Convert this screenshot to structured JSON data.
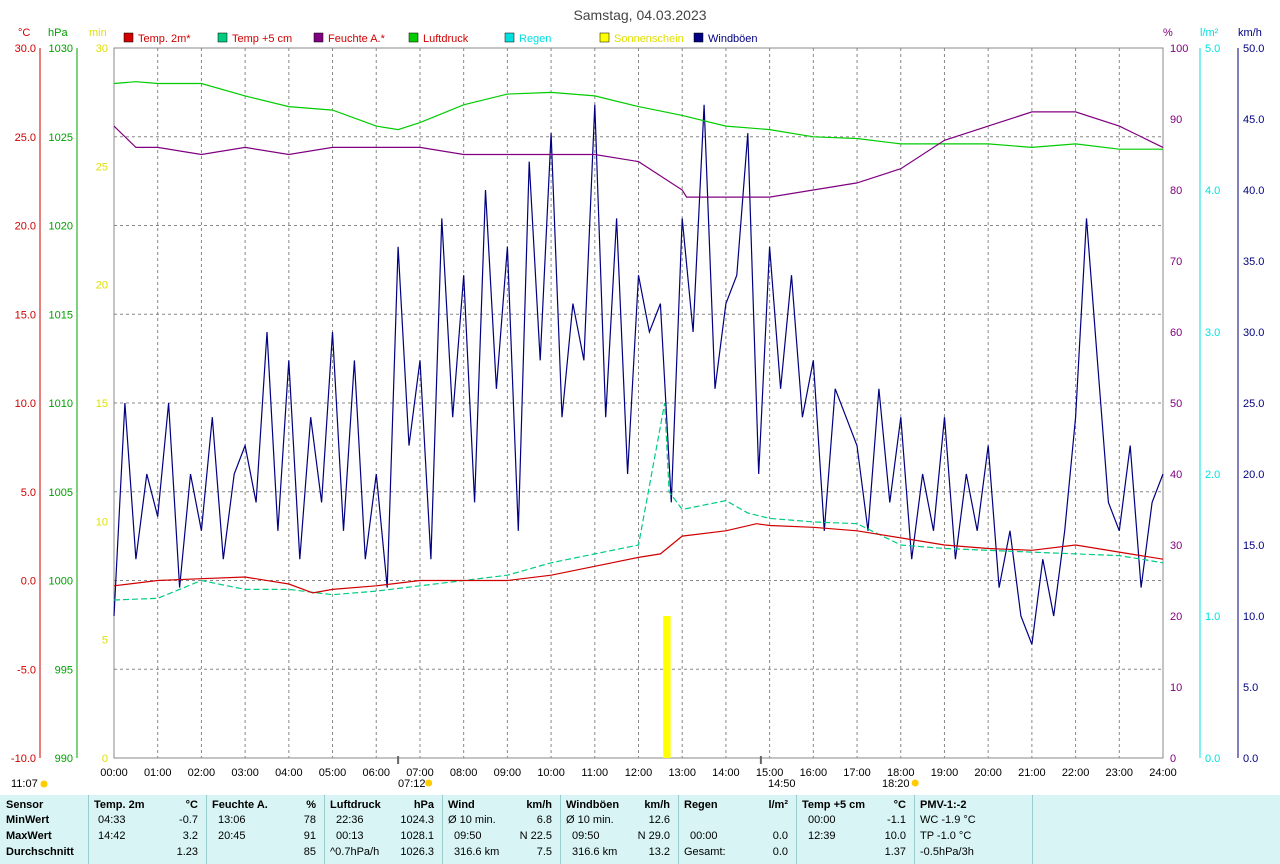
{
  "title": "Samstag, 04.03.2023",
  "units": {
    "temp": "°C",
    "pressure": "hPa",
    "sun": "min",
    "humidity": "%",
    "rain": "l/m²",
    "wind": "km/h"
  },
  "legend": [
    {
      "label": "Temp. 2m*",
      "color": "#d00000",
      "text_color": "#d00000"
    },
    {
      "label": "Temp +5 cm",
      "color": "#00cc80",
      "text_color": "#d00000"
    },
    {
      "label": "Feuchte A.*",
      "color": "#800080",
      "text_color": "#d00000"
    },
    {
      "label": "Luftdruck",
      "color": "#00cc00",
      "text_color": "#d00000"
    },
    {
      "label": "Regen",
      "color": "#00e0e0",
      "text_color": "#00e0e0"
    },
    {
      "label": "Sonnenschein",
      "color": "#ffff00",
      "text_color": "#e0e000"
    },
    {
      "label": "Windböen",
      "color": "#000080",
      "text_color": "#000080"
    }
  ],
  "axes": {
    "temp_ticks": [
      "30.0",
      "25.0",
      "20.0",
      "15.0",
      "10.0",
      "5.0",
      "0.0",
      "-5.0",
      "-10.0"
    ],
    "pressure_ticks": [
      "1030",
      "1025",
      "1020",
      "1015",
      "1010",
      "1005",
      "1000",
      "995",
      "990"
    ],
    "sun_ticks": [
      "30",
      "25",
      "20",
      "15",
      "10",
      "5",
      "0"
    ],
    "humidity_ticks": [
      "100",
      "90",
      "80",
      "70",
      "60",
      "50",
      "40",
      "30",
      "20",
      "10",
      "0"
    ],
    "rain_ticks": [
      "5.0",
      "4.0",
      "3.0",
      "2.0",
      "1.0",
      "0.0"
    ],
    "wind_ticks": [
      "50.0",
      "45.0",
      "40.0",
      "35.0",
      "30.0",
      "25.0",
      "20.0",
      "15.0",
      "10.0",
      "5.0",
      "0.0"
    ],
    "x_ticks": [
      "00:00",
      "01:00",
      "02:00",
      "03:00",
      "04:00",
      "05:00",
      "06:00",
      "07:00",
      "08:00",
      "09:00",
      "10:00",
      "11:00",
      "12:00",
      "13:00",
      "14:00",
      "15:00",
      "16:00",
      "17:00",
      "18:00",
      "19:00",
      "20:00",
      "21:00",
      "22:00",
      "23:00",
      "24:00"
    ]
  },
  "sun_markers": {
    "noon": "11:07",
    "sunrise": "07:12",
    "sunset": "18:20",
    "moon": "14:50"
  },
  "chart_data": {
    "type": "line",
    "title": "Samstag, 04.03.2023",
    "x_unit": "hour",
    "xlim": [
      0,
      24
    ],
    "series": [
      {
        "name": "Temp. 2m*",
        "axis": "temp",
        "ylim": [
          -10,
          30
        ],
        "x": [
          0,
          1,
          2,
          3,
          4,
          4.55,
          5,
          6,
          7,
          8,
          9,
          10,
          11,
          12,
          12.5,
          13,
          14,
          14.7,
          15,
          16,
          17,
          18,
          19,
          20,
          21,
          22,
          23,
          24
        ],
        "values": [
          -0.3,
          0.0,
          0.1,
          0.2,
          -0.2,
          -0.7,
          -0.5,
          -0.3,
          0.0,
          0.0,
          0.0,
          0.3,
          0.8,
          1.3,
          1.5,
          2.5,
          2.8,
          3.2,
          3.1,
          3.0,
          2.8,
          2.4,
          2.0,
          1.8,
          1.7,
          2.0,
          1.6,
          1.2
        ]
      },
      {
        "name": "Temp +5 cm",
        "axis": "temp",
        "ylim": [
          -10,
          30
        ],
        "x": [
          0,
          1,
          2,
          3,
          4,
          5,
          6,
          7,
          8,
          9,
          10,
          11,
          12,
          12.6,
          12.7,
          13,
          14,
          14.5,
          15,
          16,
          17,
          18,
          19,
          20,
          21,
          22,
          23,
          24
        ],
        "values": [
          -1.1,
          -1.0,
          0.0,
          -0.5,
          -0.5,
          -0.8,
          -0.6,
          -0.3,
          0.0,
          0.3,
          1.0,
          1.5,
          2.0,
          10.0,
          5.0,
          4.0,
          4.5,
          3.8,
          3.5,
          3.3,
          3.2,
          2.0,
          1.8,
          1.7,
          1.6,
          1.5,
          1.4,
          1.0
        ]
      },
      {
        "name": "Feuchte A.*",
        "axis": "humidity",
        "ylim": [
          0,
          100
        ],
        "x": [
          0,
          0.5,
          1,
          2,
          3,
          4,
          5,
          6,
          7,
          8,
          9,
          10,
          11,
          12,
          13,
          13.1,
          13.5,
          14,
          15,
          16,
          17,
          18,
          19,
          20,
          21,
          22,
          23,
          24
        ],
        "values": [
          89,
          86,
          86,
          85,
          86,
          85,
          86,
          86,
          86,
          85,
          85,
          85,
          85,
          84,
          80,
          79,
          79,
          79,
          79,
          80,
          81,
          83,
          87,
          89,
          91,
          91,
          89,
          86
        ]
      },
      {
        "name": "Luftdruck",
        "axis": "pressure",
        "ylim": [
          990,
          1030
        ],
        "x": [
          0,
          0.5,
          1,
          2,
          3,
          4,
          5,
          6,
          6.5,
          7,
          8,
          9,
          10,
          11,
          12,
          13,
          14,
          15,
          16,
          17,
          18,
          19,
          20,
          21,
          22,
          23,
          24
        ],
        "values": [
          1028.0,
          1028.1,
          1028.0,
          1028.0,
          1027.3,
          1026.7,
          1026.5,
          1025.6,
          1025.4,
          1025.8,
          1026.8,
          1027.4,
          1027.5,
          1027.3,
          1026.7,
          1026.2,
          1025.6,
          1025.4,
          1025.0,
          1024.9,
          1024.6,
          1024.6,
          1024.6,
          1024.4,
          1024.6,
          1024.3,
          1024.3
        ]
      },
      {
        "name": "Windböen",
        "axis": "wind",
        "ylim": [
          0,
          50
        ],
        "x": [
          0,
          0.25,
          0.5,
          0.75,
          1,
          1.25,
          1.5,
          1.75,
          2,
          2.25,
          2.5,
          2.75,
          3,
          3.25,
          3.5,
          3.75,
          4,
          4.25,
          4.5,
          4.75,
          5,
          5.25,
          5.5,
          5.75,
          6,
          6.25,
          6.5,
          6.75,
          7,
          7.25,
          7.5,
          7.75,
          8,
          8.25,
          8.5,
          8.75,
          9,
          9.25,
          9.5,
          9.75,
          10,
          10.25,
          10.5,
          10.75,
          11,
          11.25,
          11.5,
          11.75,
          12,
          12.25,
          12.5,
          12.75,
          13,
          13.25,
          13.5,
          13.75,
          14,
          14.25,
          14.5,
          14.75,
          15,
          15.25,
          15.5,
          15.75,
          16,
          16.25,
          16.5,
          16.75,
          17,
          17.25,
          17.5,
          17.75,
          18,
          18.25,
          18.5,
          18.75,
          19,
          19.25,
          19.5,
          19.75,
          20,
          20.25,
          20.5,
          20.75,
          21,
          21.25,
          21.5,
          21.75,
          22,
          22.25,
          22.5,
          22.75,
          23,
          23.25,
          23.5,
          23.75,
          24
        ],
        "values": [
          10,
          25,
          14,
          20,
          17,
          25,
          12,
          20,
          16,
          24,
          14,
          20,
          22,
          18,
          30,
          16,
          28,
          14,
          24,
          18,
          30,
          16,
          28,
          14,
          20,
          12,
          36,
          22,
          28,
          14,
          38,
          24,
          34,
          18,
          40,
          26,
          36,
          16,
          42,
          28,
          44,
          24,
          32,
          28,
          46,
          24,
          38,
          20,
          34,
          30,
          32,
          18,
          38,
          30,
          46,
          26,
          32,
          34,
          44,
          20,
          36,
          26,
          34,
          24,
          28,
          16,
          26,
          24,
          22,
          16,
          26,
          18,
          24,
          14,
          20,
          16,
          24,
          14,
          20,
          16,
          22,
          12,
          16,
          10,
          8,
          14,
          10,
          16,
          24,
          38,
          28,
          18,
          16,
          22,
          12,
          18,
          20
        ]
      },
      {
        "name": "Sonnenschein",
        "axis": "sun",
        "ylim": [
          0,
          30
        ],
        "x": [
          12.6,
          12.65,
          12.7
        ],
        "values": [
          6,
          6,
          6
        ]
      }
    ]
  },
  "stats": {
    "sensor": {
      "header": "Sensor",
      "rows": [
        "MinWert",
        "MaxWert",
        "Durchschnitt"
      ]
    },
    "temp2m": {
      "header": "Temp. 2m",
      "unit": "°C",
      "rows": [
        {
          "time": "04:33",
          "val": "-0.7"
        },
        {
          "time": "14:42",
          "val": "3.2"
        },
        {
          "time": "",
          "val": "1.23"
        }
      ]
    },
    "humidity": {
      "header": "Feuchte A.",
      "unit": "%",
      "rows": [
        {
          "time": "13:06",
          "val": "78"
        },
        {
          "time": "20:45",
          "val": "91"
        },
        {
          "time": "",
          "val": "85"
        }
      ]
    },
    "pressure": {
      "header": "Luftdruck",
      "unit": "hPa",
      "rows": [
        {
          "time": "22:36",
          "val": "1024.3"
        },
        {
          "time": "00:13",
          "val": "1028.1"
        },
        {
          "time": "^0.7hPa/h",
          "val": "1026.3"
        }
      ]
    },
    "wind": {
      "header": "Wind",
      "unit": "km/h",
      "rows": [
        {
          "time": "Ø 10 min.",
          "val": "6.8"
        },
        {
          "time": "09:50",
          "val": "N 22.5"
        },
        {
          "time": "316.6 km",
          "val": "7.5"
        }
      ]
    },
    "gusts": {
      "header": "Windböen",
      "unit": "km/h",
      "rows": [
        {
          "time": "Ø 10 min.",
          "val": "12.6"
        },
        {
          "time": "09:50",
          "val": "N 29.0"
        },
        {
          "time": "316.6 km",
          "val": "13.2"
        }
      ]
    },
    "rain": {
      "header": "Regen",
      "unit": "l/m²",
      "rows": [
        {
          "time": "",
          "val": ""
        },
        {
          "time": "00:00",
          "val": "0.0"
        },
        {
          "time": "Gesamt:",
          "val": "0.0"
        }
      ]
    },
    "temp5": {
      "header": "Temp +5 cm",
      "unit": "°C",
      "rows": [
        {
          "time": "00:00",
          "val": "-1.1"
        },
        {
          "time": "12:39",
          "val": "10.0"
        },
        {
          "time": "",
          "val": "1.37"
        }
      ]
    },
    "pmv": {
      "header": "PMV-1:-2",
      "rows": [
        "WC -1.9 °C",
        "TP -1.0 °C",
        "-0.5hPa/3h"
      ]
    }
  }
}
